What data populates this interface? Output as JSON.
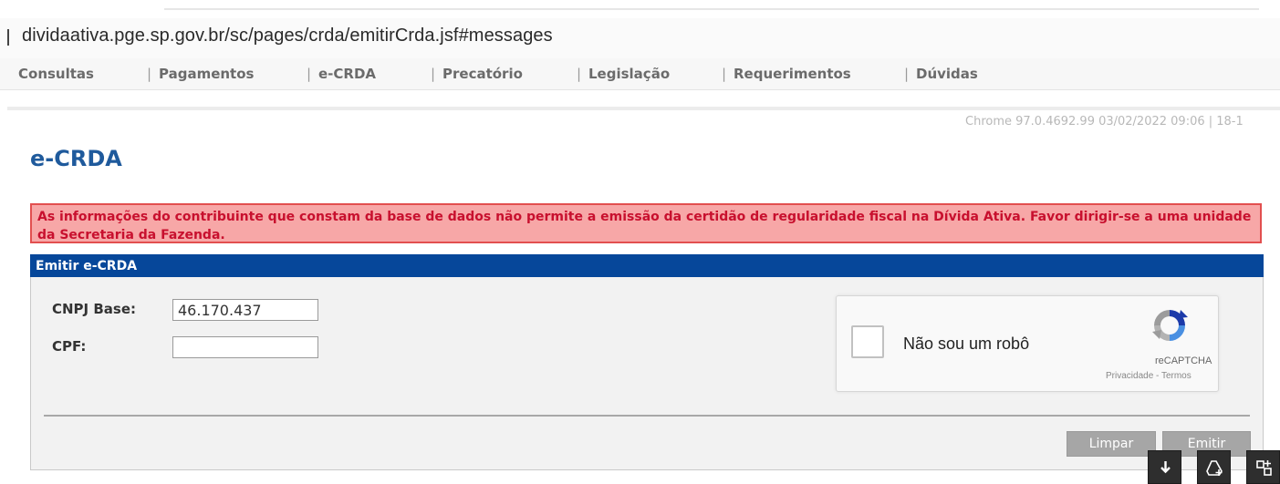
{
  "browser": {
    "url": "dividaativa.pge.sp.gov.br/sc/pages/crda/emitirCrda.jsf#messages"
  },
  "nav": {
    "items": [
      "Consultas",
      "Pagamentos",
      "e-CRDA",
      "Precatório",
      "Legislação",
      "Requerimentos",
      "Dúvidas"
    ],
    "separator": "|"
  },
  "header_info": "Chrome 97.0.4692.99  03/02/2022 09:06 | 18-1",
  "page": {
    "title": "e-CRDA",
    "error_message": "As informações do contribuinte que constam da base de dados não permite a emissão da certidão de regularidade fiscal na Dívida Ativa. Favor dirigir-se a uma unidade da Secretaria da Fazenda."
  },
  "form": {
    "header": "Emitir e-CRDA",
    "cnpj_label": "CNPJ Base:",
    "cnpj_value": "46.170.437",
    "cpf_label": "CPF:",
    "cpf_value": ""
  },
  "recaptcha": {
    "label": "Não sou um robô",
    "brand": "reCAPTCHA",
    "terms": "Privacidade - Termos"
  },
  "buttons": {
    "clear": "Limpar",
    "submit": "Emitir"
  },
  "toolbar_icons": [
    "download-icon",
    "add-to-drive-icon",
    "screenshot-tool-icon"
  ],
  "colors": {
    "title": "#1f5a9c",
    "panel_header": "#06479a",
    "error_bg": "#f7a7a7",
    "error_text": "#c8102e",
    "button": "#a6a6a6"
  }
}
